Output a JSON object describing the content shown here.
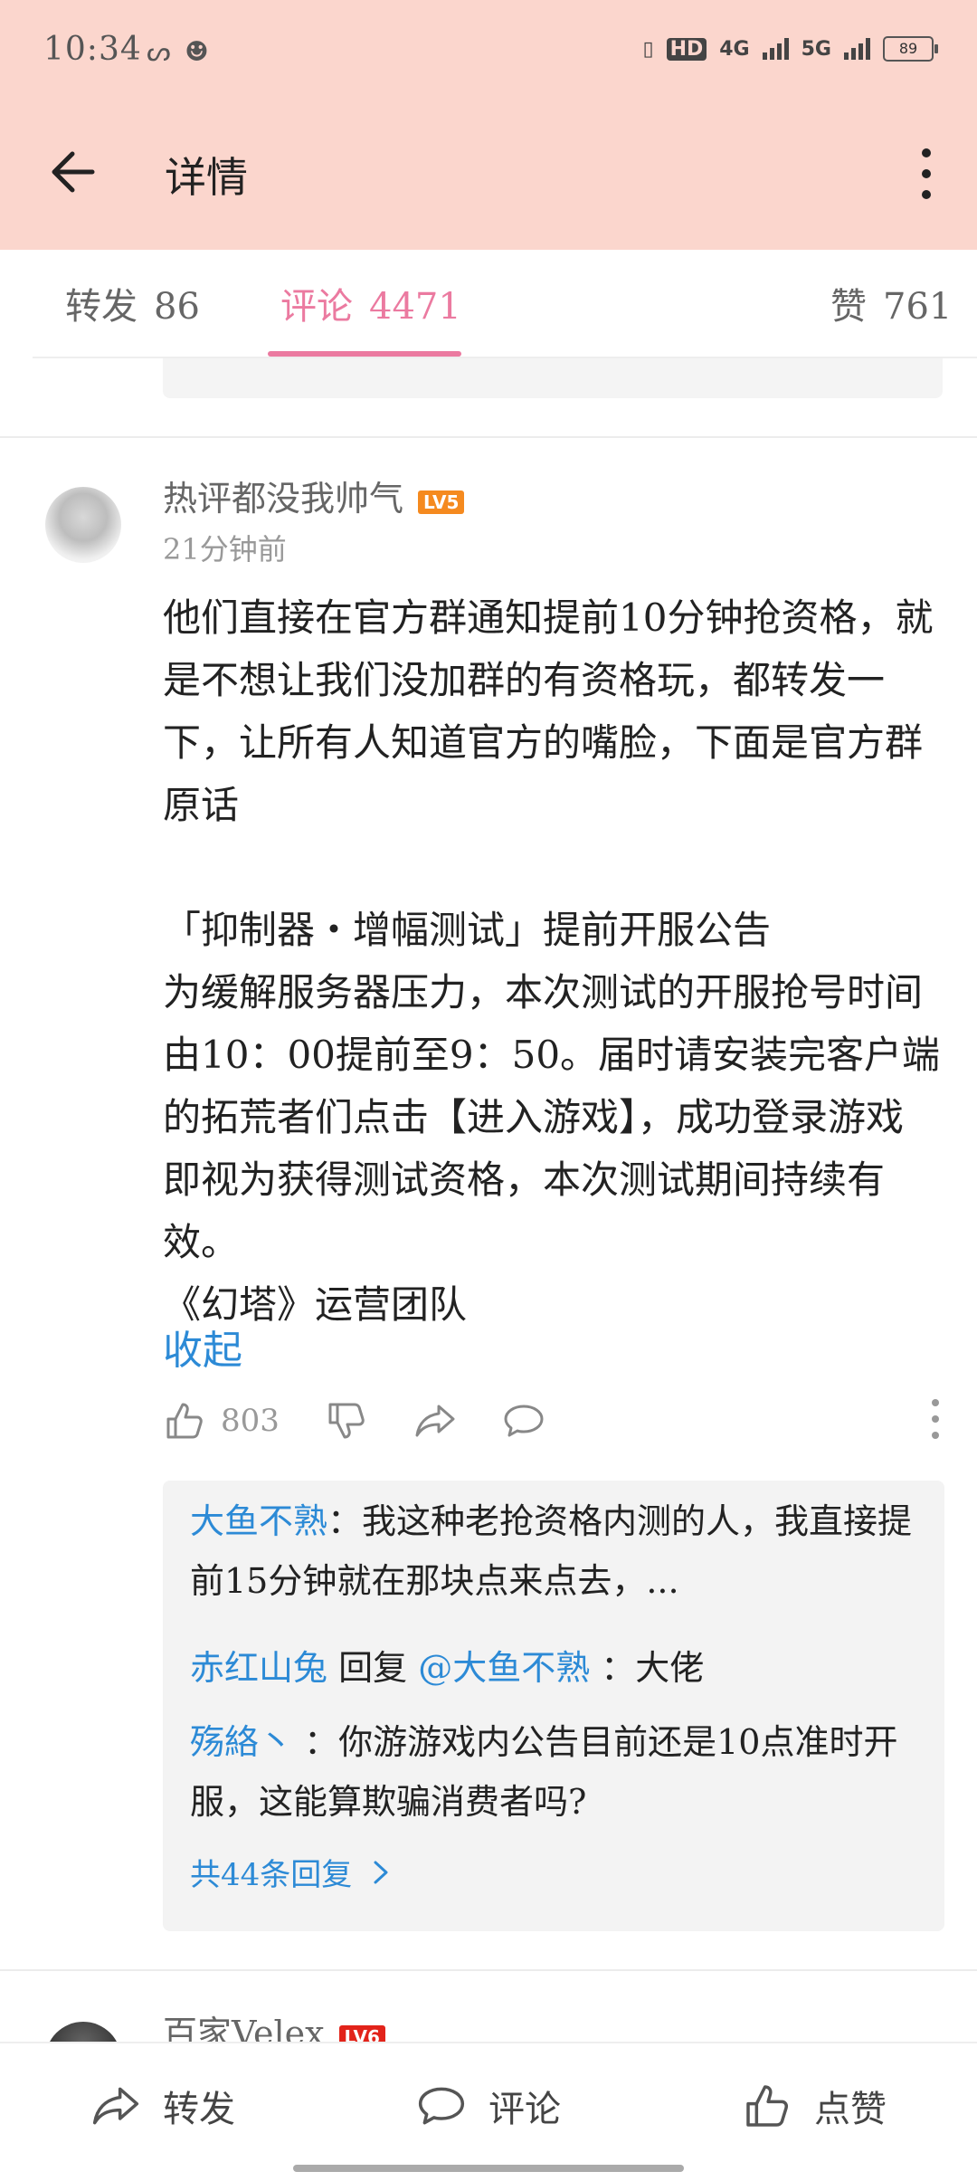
{
  "status_bar": {
    "time": "10:34",
    "battery": "89",
    "network_1": "4G",
    "network_2": "5G",
    "hd": "HD"
  },
  "header": {
    "title": "详情"
  },
  "tabs": [
    {
      "label": "转发",
      "count": "86"
    },
    {
      "label": "评论",
      "count": "4471"
    },
    {
      "label": "赞",
      "count": "761"
    }
  ],
  "comment": {
    "username": "热评都没我帅气",
    "level": "LV5",
    "time": "21分钟前",
    "text": "他们直接在官方群通知提前10分钟抢资格，就是不想让我们没加群的有资格玩，都转发一下，让所有人知道官方的嘴脸，下面是官方群原话\n\n「抑制器・增幅测试」提前开服公告\n为缓解服务器压力，本次测试的开服抢号时间由10：00提前至9：50。届时请安装完客户端的拓荒者们点击【进入游戏】，成功登录游戏即视为获得测试资格，本次测试期间持续有效。\n《幻塔》运营团队",
    "collapse_label": "收起",
    "like_count": "803"
  },
  "replies": [
    {
      "name": "大鱼不熟",
      "sep": "：",
      "text": "我这种老抢资格内测的人，我直接提前15分钟就在那块点来点去，..."
    },
    {
      "name": "赤红山兔",
      "mid": " 回复 ",
      "mention": "@大鱼不熟",
      "text": " ：大佬"
    },
    {
      "name": "殇絡丶",
      "sep": " ：",
      "text": "你游游戏内公告目前还是10点准时开服，这能算欺骗消费者吗?"
    }
  ],
  "reply_more": "共44条回复",
  "next_comment": {
    "username": "百家Velex",
    "level": "LV6"
  },
  "bottom_bar": {
    "repost": "转发",
    "comment": "评论",
    "like": "点赞"
  }
}
